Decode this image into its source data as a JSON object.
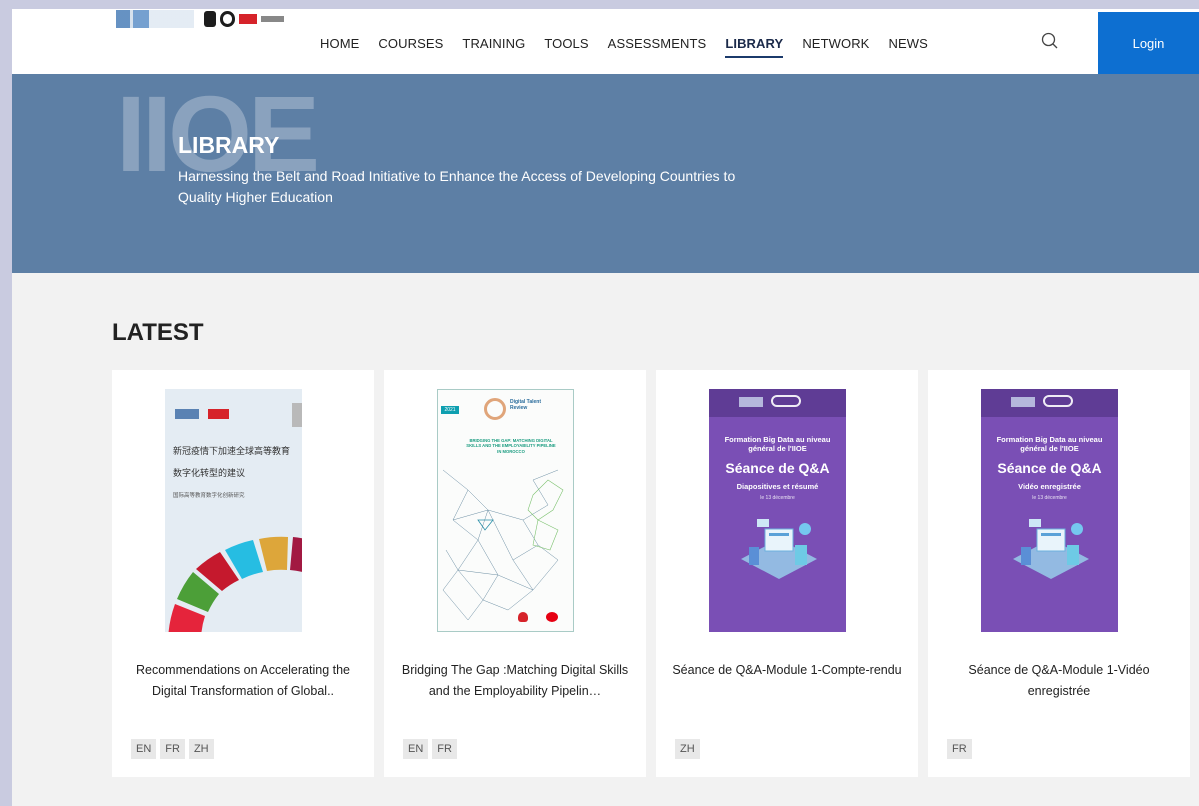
{
  "header": {
    "nav": [
      "HOME",
      "COURSES",
      "TRAINING",
      "TOOLS",
      "ASSESSMENTS",
      "LIBRARY",
      "NETWORK",
      "NEWS"
    ],
    "active_nav": "LIBRARY",
    "login_label": "Login"
  },
  "hero": {
    "watermark": "IIOE",
    "title": "LIBRARY",
    "subtitle": "Harnessing the Belt and Road Initiative to Enhance the Access of Developing Countries to Quality Higher Education"
  },
  "latest": {
    "title": "LATEST",
    "cards": [
      {
        "title": "Recommendations on Accelerating the Digital Transformation of Global..",
        "tags": [
          "EN",
          "FR",
          "ZH"
        ],
        "cover": {
          "line1": "新冠疫情下加速全球高等教育",
          "line2": "数字化转型的建议",
          "line3": "国际高等教育数字化创新研究"
        }
      },
      {
        "title": "Bridging The Gap :Matching Digital Skills and the Employability Pipelin…",
        "tags": [
          "EN",
          "FR"
        ],
        "cover": {
          "year": "2021",
          "brand": "Digital Talent Review",
          "heading": "BRIDGING THE GAP: MATCHING DIGITAL SKILLS AND THE EMPLOYABILITY PIPELINE IN MOROCCO"
        }
      },
      {
        "title": "Séance de Q&A-Module 1-Compte-rendu",
        "tags": [
          "ZH"
        ],
        "cover": {
          "l1": "Formation Big Data au niveau général de l'IIOE",
          "l2": "Séance de Q&A",
          "l3": "Diapositives et résumé",
          "l4": "le 13 décembre"
        }
      },
      {
        "title": "Séance de Q&A-Module 1-Vidéo enregistrée",
        "tags": [
          "FR"
        ],
        "cover": {
          "l1": "Formation Big Data au niveau général de l'IIOE",
          "l2": "Séance de Q&A",
          "l3": "Vidéo enregistrée",
          "l4": "le 13 décembre"
        }
      }
    ]
  },
  "colors": {
    "hero_bg": "#5d7fa5",
    "login_bg": "#0d6fd1",
    "page_bg": "#f2f2f2",
    "cover_purple": "#7a4fb5"
  }
}
